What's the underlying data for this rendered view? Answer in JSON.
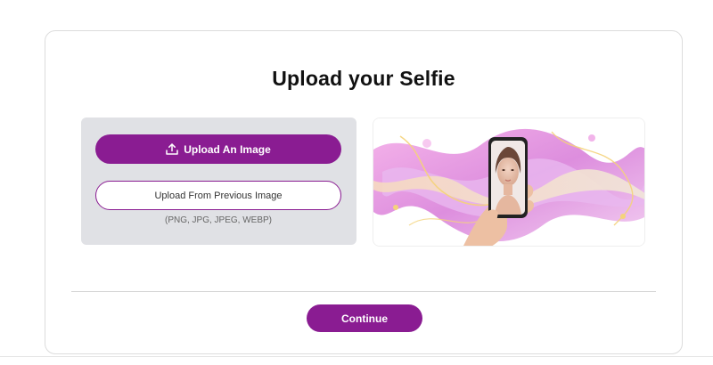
{
  "page": {
    "title": "Upload your Selfie"
  },
  "upload": {
    "primary_label": "Upload An Image",
    "primary_icon": "upload-icon",
    "secondary_label": "Upload From Previous Image",
    "formats": "(PNG, JPG, JPEG, WEBP)"
  },
  "footer": {
    "continue_label": "Continue"
  },
  "colors": {
    "accent": "#8a1c92",
    "panel_bg": "#e0e1e5"
  }
}
